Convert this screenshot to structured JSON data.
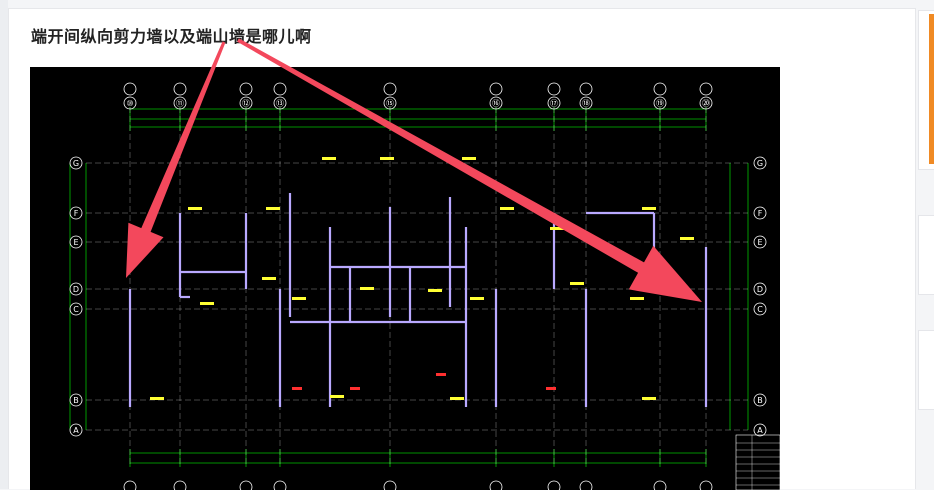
{
  "post": {
    "title": "端开间纵向剪力墙以及端山墙是哪儿啊"
  },
  "drawing": {
    "column_labels": [
      "⑩",
      "⑪",
      "⑫",
      "⑬",
      "⑮",
      "⑯",
      "⑰",
      "⑱",
      "⑲",
      "⑳"
    ],
    "row_labels": [
      "G",
      "F",
      "E",
      "D",
      "C",
      "B",
      "A"
    ],
    "background_color": "#000000",
    "axis_color": "#ffffff",
    "dimension_color": "#00c000",
    "wall_color": "#b9a9ff",
    "tag_color": "#ffff33",
    "note_color": "#ff3030"
  },
  "annotation": {
    "arrow_color": "#f3485c",
    "arrow_count": 2
  }
}
